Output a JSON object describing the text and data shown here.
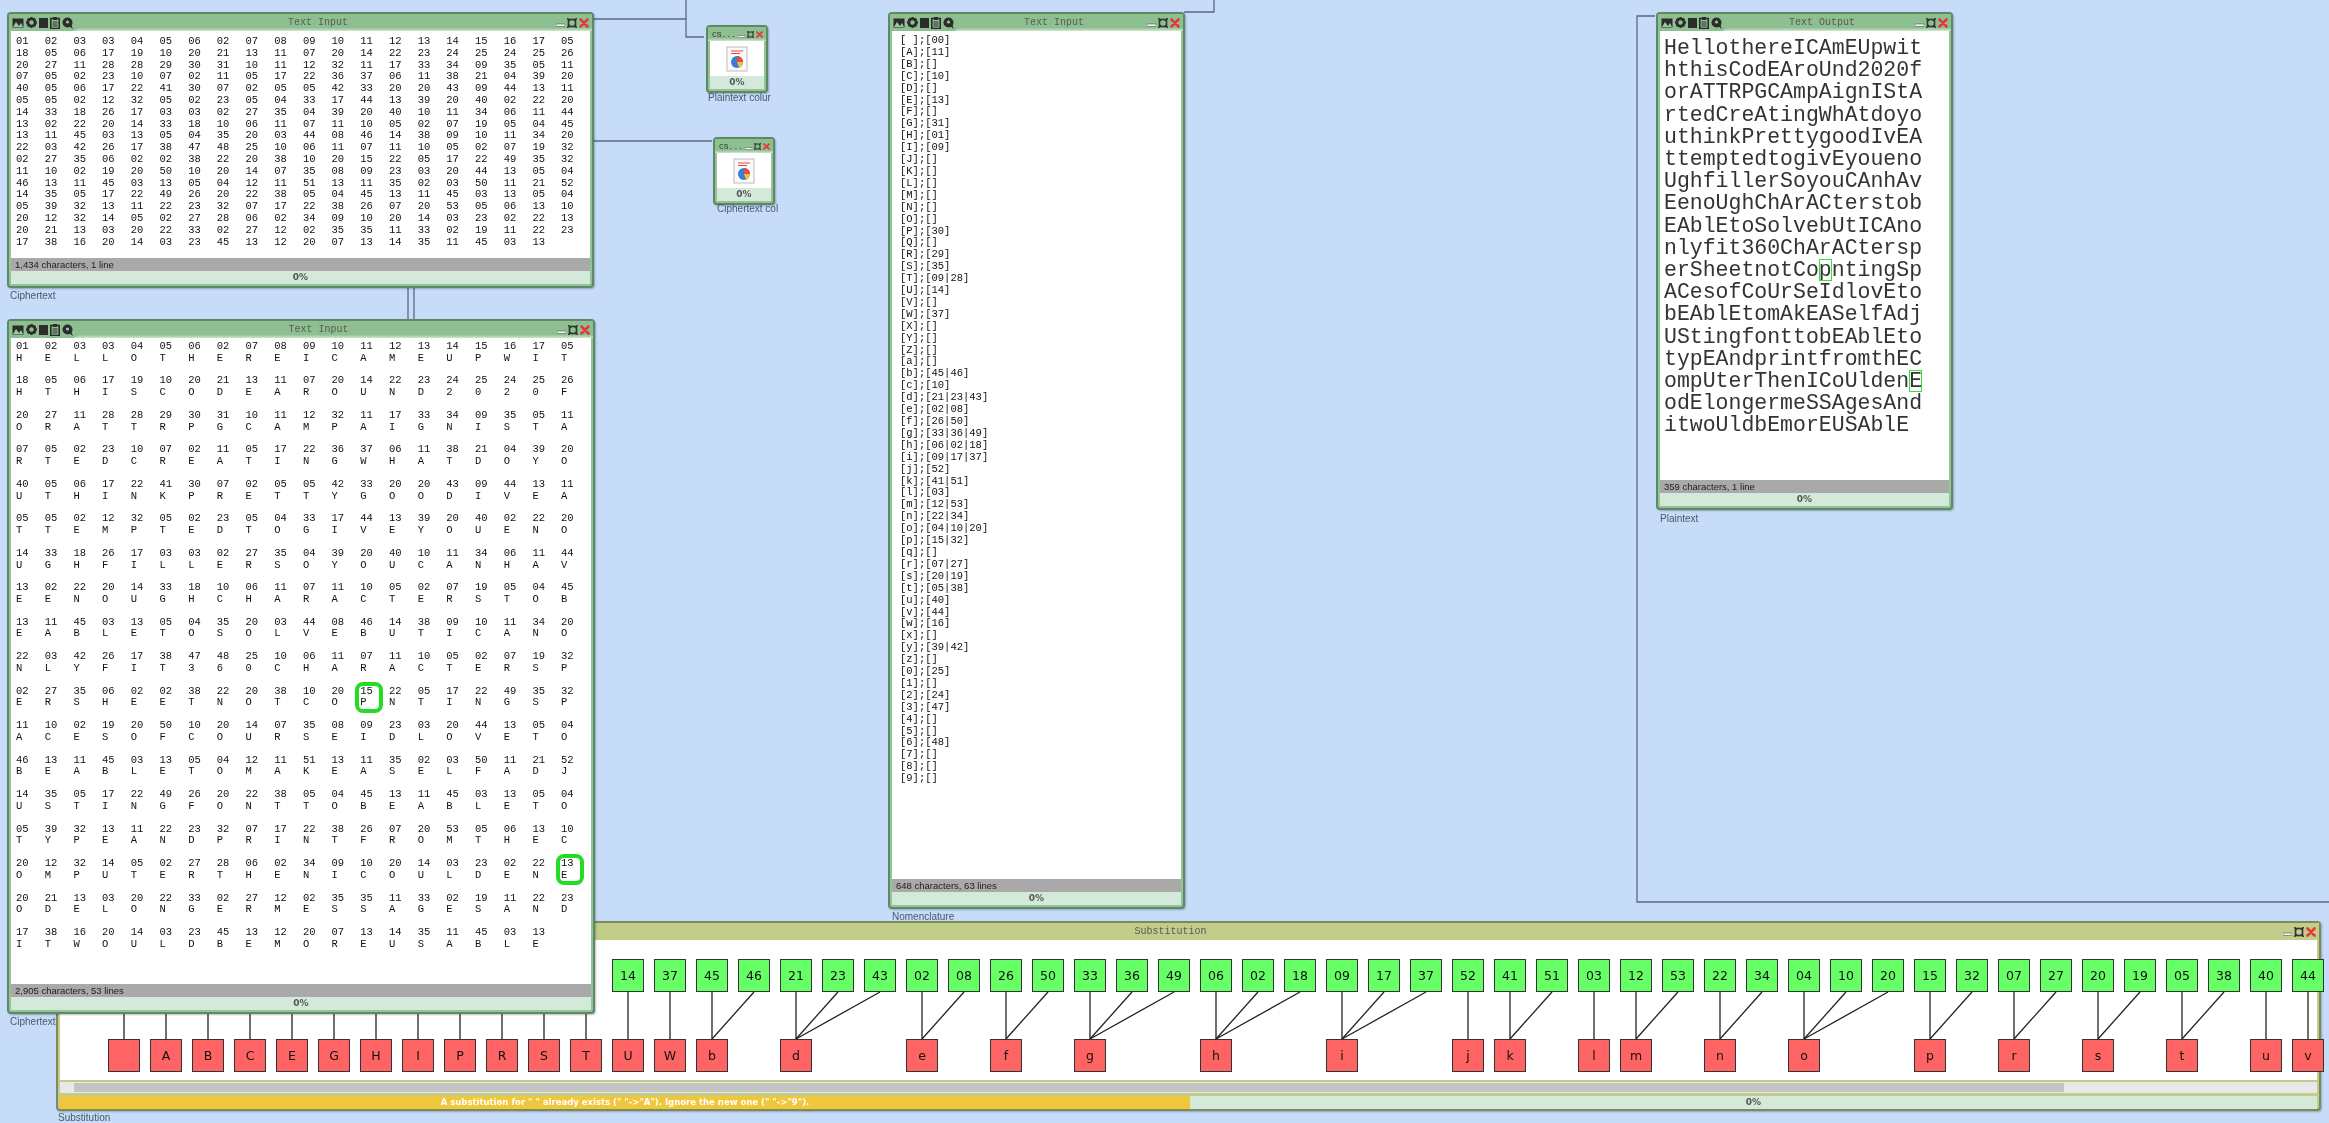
{
  "ciphertext_input": {
    "title": "Text Input",
    "label": "Ciphertext",
    "status": "1,434 characters, 1 line",
    "progress": {
      "label": "0%",
      "level": 0
    },
    "rows": [
      "01 02 03 03 04 05 06 02 07 08 09 10 11 12 13 14 15 16 17 05",
      "18 05 06 17 19 10 20 21 13 11 07 20 14 22 23 24 25 24 25 26",
      "20 27 11 28 28 29 30 31 10 11 12 32 11 17 33 34 09 35 05 11",
      "07 05 02 23 10 07 02 11 05 17 22 36 37 06 11 38 21 04 39 20",
      "40 05 06 17 22 41 30 07 02 05 05 42 33 20 20 43 09 44 13 11",
      "05 05 02 12 32 05 02 23 05 04 33 17 44 13 39 20 40 02 22 20",
      "14 33 18 26 17 03 03 02 27 35 04 39 20 40 10 11 34 06 11 44",
      "13 02 22 20 14 33 18 10 06 11 07 11 10 05 02 07 19 05 04 45",
      "13 11 45 03 13 05 04 35 20 03 44 08 46 14 38 09 10 11 34 20",
      "22 03 42 26 17 38 47 48 25 10 06 11 07 11 10 05 02 07 19 32",
      "02 27 35 06 02 02 38 22 20 38 10 20 15 22 05 17 22 49 35 32",
      "11 10 02 19 20 50 10 20 14 07 35 08 09 23 03 20 44 13 05 04",
      "46 13 11 45 03 13 05 04 12 11 51 13 11 35 02 03 50 11 21 52",
      "14 35 05 17 22 49 26 20 22 38 05 04 45 13 11 45 03 13 05 04",
      "05 39 32 13 11 22 23 32 07 17 22 38 26 07 20 53 05 06 13 10",
      "20 12 32 14 05 02 27 28 06 02 34 09 10 20 14 03 23 02 22 13",
      "20 21 13 03 20 22 33 02 27 12 02 35 35 11 33 02 19 11 22 23",
      "17 38 16 20 14 03 23 45 13 12 20 07 13 14 35 11 45 03 13"
    ]
  },
  "plaintext_colorizer": {
    "title": "CS...",
    "label": "Plaintext colur",
    "progress": {
      "label": "0%",
      "level": 0
    }
  },
  "ciphertext_colorizer": {
    "title": "CS...",
    "label": "Ciphertext col",
    "progress": {
      "label": "0%",
      "level": 0
    }
  },
  "colorized_input": {
    "title": "Text Input",
    "label": "Ciphertext",
    "status": "2,905 characters, 53 lines",
    "progress": {
      "label": "0%",
      "level": 0
    },
    "rows": [
      {
        "codes": "01 02 03 03 04 05 06 02 07 08 09 10 11 12 13 14 15 16 17 05",
        "letters": "H E L L O T H E R E I C A M E U P W I T",
        "highlighted": [
          false,
          false,
          false,
          false,
          false,
          false,
          false,
          false,
          false,
          false,
          false,
          false,
          false,
          false,
          false,
          false,
          false,
          false,
          false,
          false
        ]
      },
      {
        "codes": "18 05 06 17 19 10 20 21 13 11 07 20 14 22 23 24 25 24 25 26",
        "letters": "H T H I S C O D E A R O U N D 2 0 2 0 F",
        "highlighted": [
          false,
          false,
          false,
          false,
          false,
          false,
          false,
          false,
          false,
          false,
          false,
          false,
          false,
          false,
          false,
          false,
          false,
          false,
          false,
          false
        ]
      },
      {
        "codes": "20 27 11 28 28 29 30 31 10 11 12 32 11 17 33 34 09 35 05 11",
        "letters": "O R A T T R P G C A M P A I G N I S T A",
        "highlighted": [
          false,
          false,
          false,
          false,
          false,
          false,
          false,
          false,
          false,
          false,
          false,
          false,
          false,
          false,
          false,
          false,
          false,
          false,
          false,
          false
        ]
      },
      {
        "codes": "07 05 02 23 10 07 02 11 05 17 22 36 37 06 11 38 21 04 39 20",
        "letters": "R T E D C R E A T I N G W H A T D O Y O",
        "highlighted": [
          false,
          false,
          false,
          false,
          false,
          false,
          false,
          false,
          false,
          false,
          false,
          false,
          false,
          false,
          false,
          false,
          false,
          false,
          false,
          false
        ]
      },
      {
        "codes": "40 05 06 17 22 41 30 07 02 05 05 42 33 20 20 43 09 44 13 11",
        "letters": "U T H I N K P R E T T Y G O O D I V E A",
        "highlighted": [
          false,
          false,
          false,
          false,
          false,
          false,
          false,
          false,
          false,
          false,
          false,
          false,
          false,
          false,
          false,
          false,
          false,
          false,
          false,
          false
        ]
      },
      {
        "codes": "05 05 02 12 32 05 02 23 05 04 33 17 44 13 39 20 40 02 22 20",
        "letters": "T T E M P T E D T O G I V E Y O U E N O",
        "highlighted": [
          false,
          false,
          false,
          false,
          false,
          false,
          false,
          false,
          false,
          false,
          false,
          false,
          false,
          false,
          false,
          false,
          false,
          false,
          false,
          false
        ]
      },
      {
        "codes": "14 33 18 26 17 03 03 02 27 35 04 39 20 40 10 11 34 06 11 44",
        "letters": "U G H F I L L E R S O Y O U C A N H A V",
        "highlighted": [
          false,
          false,
          false,
          false,
          false,
          false,
          false,
          false,
          false,
          false,
          false,
          false,
          false,
          false,
          false,
          false,
          false,
          false,
          false,
          false
        ]
      },
      {
        "codes": "13 02 22 20 14 33 18 10 06 11 07 11 10 05 02 07 19 05 04 45",
        "letters": "E E N O U G H C H A R A C T E R S T O B",
        "highlighted": [
          false,
          false,
          false,
          false,
          false,
          false,
          false,
          false,
          false,
          false,
          false,
          false,
          false,
          false,
          false,
          false,
          false,
          false,
          false,
          false
        ]
      },
      {
        "codes": "13 11 45 03 13 05 04 35 20 03 44 08 46 14 38 09 10 11 34 20",
        "letters": "E A B L E T O S O L V E B U T I C A N O",
        "highlighted": [
          false,
          false,
          false,
          false,
          false,
          false,
          false,
          false,
          false,
          false,
          false,
          false,
          false,
          false,
          false,
          false,
          false,
          false,
          false,
          false
        ]
      },
      {
        "codes": "22 03 42 26 17 38 47 48 25 10 06 11 07 11 10 05 02 07 19 32",
        "letters": "N L Y F I T 3 6 0 C H A R A C T E R S P",
        "highlighted": [
          false,
          false,
          false,
          false,
          false,
          false,
          false,
          false,
          false,
          false,
          false,
          false,
          false,
          false,
          false,
          false,
          false,
          false,
          false,
          false
        ]
      },
      {
        "codes": "02 27 35 06 02 02 38 22 20 38 10 20 15 22 05 17 22 49 35 32",
        "letters": "E R S H E E T N O T C O P N T I N G S P",
        "highlighted": [
          false,
          false,
          false,
          false,
          false,
          false,
          false,
          false,
          false,
          false,
          false,
          false,
          true,
          false,
          false,
          false,
          false,
          false,
          false,
          false
        ]
      },
      {
        "codes": "11 10 02 19 20 50 10 20 14 07 35 08 09 23 03 20 44 13 05 04",
        "letters": "A C E S O F C O U R S E I D L O V E T O",
        "highlighted": [
          false,
          false,
          false,
          false,
          false,
          false,
          false,
          false,
          false,
          false,
          false,
          false,
          false,
          false,
          false,
          false,
          false,
          false,
          false,
          false
        ]
      },
      {
        "codes": "46 13 11 45 03 13 05 04 12 11 51 13 11 35 02 03 50 11 21 52",
        "letters": "B E A B L E T O M A K E A S E L F A D J",
        "highlighted": [
          false,
          false,
          false,
          false,
          false,
          false,
          false,
          false,
          false,
          false,
          false,
          false,
          false,
          false,
          false,
          false,
          false,
          false,
          false,
          false
        ]
      },
      {
        "codes": "14 35 05 17 22 49 26 20 22 38 05 04 45 13 11 45 03 13 05 04",
        "letters": "U S T I N G F O N T T O B E A B L E T O",
        "highlighted": [
          false,
          false,
          false,
          false,
          false,
          false,
          false,
          false,
          false,
          false,
          false,
          false,
          false,
          false,
          false,
          false,
          false,
          false,
          false,
          false
        ]
      },
      {
        "codes": "05 39 32 13 11 22 23 32 07 17 22 38 26 07 20 53 05 06 13 10",
        "letters": "T Y P E A N D P R I N T F R O M T H E C",
        "highlighted": [
          false,
          false,
          false,
          false,
          false,
          false,
          false,
          false,
          false,
          false,
          false,
          false,
          false,
          false,
          false,
          false,
          false,
          false,
          false,
          false
        ]
      },
      {
        "codes": "20 12 32 14 05 02 27 28 06 02 34 09 10 20 14 03 23 02 22 13",
        "letters": "O M P U T E R T H E N I C O U L D E N E",
        "highlighted": [
          false,
          false,
          false,
          false,
          false,
          false,
          false,
          false,
          false,
          false,
          false,
          false,
          false,
          false,
          false,
          false,
          false,
          false,
          false,
          true
        ]
      },
      {
        "codes": "20 21 13 03 20 22 33 02 27 12 02 35 35 11 33 02 19 11 22 23",
        "letters": "O D E L O N G E R M E S S A G E S A N D",
        "highlighted": [
          false,
          false,
          false,
          false,
          false,
          false,
          false,
          false,
          false,
          false,
          false,
          false,
          false,
          false,
          false,
          false,
          false,
          false,
          false,
          false
        ]
      },
      {
        "codes": "17 38 16 20 14 03 23 45 13 12 20 07 13 14 35 11 45 03 13",
        "letters": "I T W O U L D B E M O R E U S A B L E",
        "highlighted": [
          false,
          false,
          false,
          false,
          false,
          false,
          false,
          false,
          false,
          false,
          false,
          false,
          false,
          false,
          false,
          false,
          false,
          false,
          false
        ]
      }
    ]
  },
  "nomenclature_input": {
    "title": "Text Input",
    "label": "Nomenclature",
    "status": "648 characters, 63 lines",
    "progress": {
      "label": "0%",
      "level": 0
    },
    "lines": [
      "[ ];[00]",
      "[A];[11]",
      "[B];[]",
      "[C];[10]",
      "[D];[]",
      "[E];[13]",
      "[F];[]",
      "[G];[31]",
      "[H];[01]",
      "[I];[09]",
      "[J];[]",
      "[K];[]",
      "[L];[]",
      "[M];[]",
      "[N];[]",
      "[O];[]",
      "[P];[30]",
      "[Q];[]",
      "[R];[29]",
      "[S];[35]",
      "[T];[09|28]",
      "[U];[14]",
      "[V];[]",
      "[W];[37]",
      "[X];[]",
      "[Y];[]",
      "[Z];[]",
      "[a];[]",
      "[b];[45|46]",
      "[c];[10]",
      "[d];[21|23|43]",
      "[e];[02|08]",
      "[f];[26|50]",
      "[g];[33|36|49]",
      "[h];[06|02|18]",
      "[i];[09|17|37]",
      "[j];[52]",
      "[k];[41|51]",
      "[l];[03]",
      "[m];[12|53]",
      "[n];[22|34]",
      "[o];[04|10|20]",
      "[p];[15|32]",
      "[q];[]",
      "[r];[07|27]",
      "[s];[20|19]",
      "[t];[05|38]",
      "[u];[40]",
      "[v];[44]",
      "[w];[16]",
      "[x];[]",
      "[y];[39|42]",
      "[z];[]",
      "[0];[25]",
      "[1];[]",
      "[2];[24]",
      "[3];[47]",
      "[4];[]",
      "[5];[]",
      "[6];[48]",
      "[7];[]",
      "[8];[]",
      "[9];[]"
    ]
  },
  "text_output": {
    "title": "Text Output",
    "label": "Plaintext",
    "status": "359 characters, 1 line",
    "progress": {
      "label": "0%",
      "level": 0
    },
    "lines": [
      {
        "parts": [
          {
            "text": "HellothereICAmEUpwit",
            "highlighted": false
          }
        ]
      },
      {
        "parts": [
          {
            "text": "hthisCodEAroUnd2020f",
            "highlighted": false
          }
        ]
      },
      {
        "parts": [
          {
            "text": "orATTRPGCAmpAignIStA",
            "highlighted": false
          }
        ]
      },
      {
        "parts": [
          {
            "text": "rtedCreAtingWhAtdoyo",
            "highlighted": false
          }
        ]
      },
      {
        "parts": [
          {
            "text": "uthinkPrettygoodIvEA",
            "highlighted": false
          }
        ]
      },
      {
        "parts": [
          {
            "text": "ttemptedtogivEyoueno",
            "highlighted": false
          }
        ]
      },
      {
        "parts": [
          {
            "text": "UghfillerSoyouCAnhAv",
            "highlighted": false
          }
        ]
      },
      {
        "parts": [
          {
            "text": "EenoUghChArACterstob",
            "highlighted": false
          }
        ]
      },
      {
        "parts": [
          {
            "text": "EAblEtoSolvebUtICAno",
            "highlighted": false
          }
        ]
      },
      {
        "parts": [
          {
            "text": "nlyfit360ChArACtersp",
            "highlighted": false
          }
        ]
      },
      {
        "parts": [
          {
            "text": "erSheetnotCo",
            "highlighted": false
          },
          {
            "text": "p",
            "highlighted": true
          },
          {
            "text": "ntingSp",
            "highlighted": false
          }
        ]
      },
      {
        "parts": [
          {
            "text": "ACesofCoUrSeIdlovEto",
            "highlighted": false
          }
        ]
      },
      {
        "parts": [
          {
            "text": "bEAblEtomAkEASelfAdj",
            "highlighted": false
          }
        ]
      },
      {
        "parts": [
          {
            "text": "UStingfonttobEAblEto",
            "highlighted": false
          }
        ]
      },
      {
        "parts": [
          {
            "text": "typEAndprintfromthEC",
            "highlighted": false
          }
        ]
      },
      {
        "parts": [
          {
            "text": "ompUterThenICoUlden",
            "highlighted": false
          },
          {
            "text": "E",
            "highlighted": true
          }
        ]
      },
      {
        "parts": [
          {
            "text": "odElongermeSSAgesAnd",
            "highlighted": false
          }
        ]
      },
      {
        "parts": [
          {
            "text": "itwoUldbEmorEUSAblE",
            "highlighted": false
          }
        ]
      }
    ]
  },
  "substitution": {
    "title": "Substitution",
    "label": "Substitution",
    "message": "A substitution for \" \" already exists (\" \"->\"A\"). Ignore the new one (\" \"->\"9\").",
    "progress": {
      "label": "0%",
      "level": 0
    },
    "mappings": [
      {
        "kind": "empty"
      },
      {
        "letter": "A"
      },
      {
        "letter": "B"
      },
      {
        "letter": "C"
      },
      {
        "letter": "E"
      },
      {
        "letter": "G"
      },
      {
        "letter": "H"
      },
      {
        "letter": "I"
      },
      {
        "letter": "P"
      },
      {
        "letter": "R"
      },
      {
        "letter": "S"
      },
      {
        "letter": "T"
      },
      {
        "letter": "U",
        "codes": [
          "14"
        ]
      },
      {
        "letter": "W",
        "codes": [
          "37"
        ]
      },
      {
        "letter": "b",
        "codes": [
          "45",
          "46"
        ]
      },
      {
        "letter": "d",
        "codes": [
          "21",
          "23",
          "43"
        ]
      },
      {
        "letter": "e",
        "codes": [
          "02",
          "08"
        ]
      },
      {
        "letter": "f",
        "codes": [
          "26",
          "50"
        ]
      },
      {
        "letter": "g",
        "codes": [
          "33",
          "36",
          "49"
        ]
      },
      {
        "letter": "h",
        "codes": [
          "06",
          "02",
          "18"
        ]
      },
      {
        "letter": "i",
        "codes": [
          "09",
          "17",
          "37"
        ]
      },
      {
        "letter": "j",
        "codes": [
          "52"
        ]
      },
      {
        "letter": "k",
        "codes": [
          "41",
          "51"
        ]
      },
      {
        "letter": "l",
        "codes": [
          "03"
        ]
      },
      {
        "letter": "m",
        "codes": [
          "12",
          "53"
        ]
      },
      {
        "letter": "n",
        "codes": [
          "22",
          "34"
        ]
      },
      {
        "letter": "o",
        "codes": [
          "04",
          "10",
          "20"
        ]
      },
      {
        "letter": "p",
        "codes": [
          "15",
          "32"
        ]
      },
      {
        "letter": "r",
        "codes": [
          "07",
          "27"
        ]
      },
      {
        "letter": "s",
        "codes": [
          "20",
          "19"
        ]
      },
      {
        "letter": "t",
        "codes": [
          "05",
          "38"
        ]
      },
      {
        "letter": "u",
        "codes": [
          "40"
        ]
      },
      {
        "letter": "v",
        "codes": [
          "44"
        ]
      }
    ]
  }
}
